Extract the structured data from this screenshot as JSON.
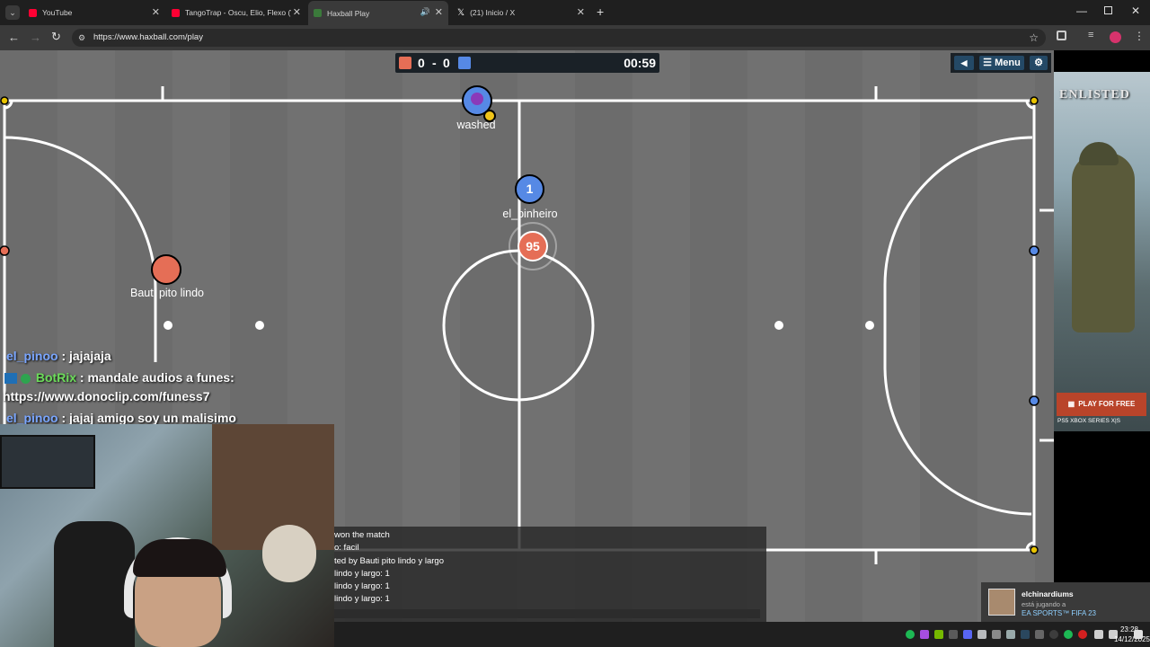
{
  "browser": {
    "tabs": [
      {
        "label": "YouTube",
        "color": "#ff0033"
      },
      {
        "label": "TangoTrap - Oscu, Elio, Flexo (V",
        "color": "#ff0033"
      },
      {
        "label": "Haxball Play",
        "color": "#3b7a3b"
      },
      {
        "label": "(21) Inicio / X",
        "color": "#ffffff"
      }
    ],
    "url": "https://www.haxball.com/play"
  },
  "scoreboard": {
    "red_score": "0",
    "separator": "-",
    "blue_score": "0",
    "timer": "00:59",
    "red_color": "#e56e56",
    "blue_color": "#5689e5"
  },
  "menu": {
    "sound_icon": "speaker-icon",
    "menu_label": "Menu",
    "settings_icon": "gear-icon"
  },
  "players": [
    {
      "name": "washed",
      "team": "blue",
      "avatar": "devil-emoji"
    },
    {
      "name": "el_pinheiro",
      "team": "blue",
      "number": "1"
    },
    {
      "name": "Bauti pito lindo",
      "team": "red"
    },
    {
      "team": "red",
      "number": "95"
    }
  ],
  "stream_chat": [
    {
      "user": "el_pinoo",
      "text": " : jajajaja"
    },
    {
      "user": "BotRix",
      "text": " : mandale audios a funes:",
      "text2": "https://www.donoclip.com/funess7"
    },
    {
      "user": "el_pinoo",
      "text": " : jajaj amigo soy un malisimo"
    }
  ],
  "game_log": [
    "won the match",
    "o: facil",
    "ted by Bauti pito lindo y largo",
    "lindo y largo: 1",
    "lindo y largo: 1",
    "lindo y largo: 1"
  ],
  "ad": {
    "title": "ENLISTED",
    "cta": "PLAY FOR FREE",
    "platforms": "PS5  XBOX SERIES X|S"
  },
  "notification": {
    "user": "elchinardiums",
    "status": "está jugando a",
    "game": "EA SPORTS™ FIFA 23"
  },
  "taskbar": {
    "time": "23:28",
    "date": "14/12/2025"
  }
}
